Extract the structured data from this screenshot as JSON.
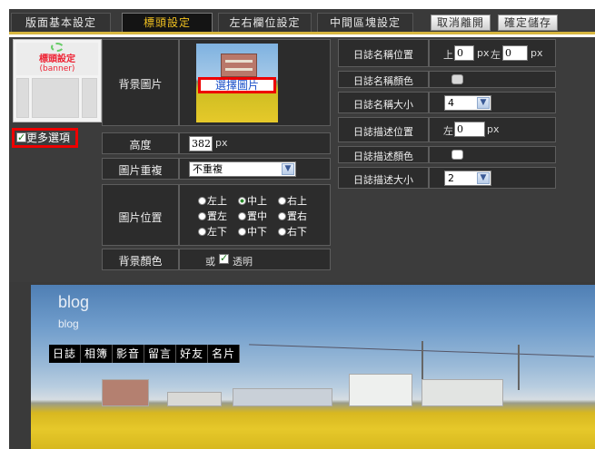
{
  "tabs": [
    {
      "label": "版面基本設定",
      "active": false
    },
    {
      "label": "標頭設定",
      "active": true
    },
    {
      "label": "左右欄位設定",
      "active": false
    },
    {
      "label": "中間區塊設定",
      "active": false
    }
  ],
  "actions": {
    "cancel": "取消離開",
    "save": "確定儲存"
  },
  "thumbnail": {
    "title": "標頭設定",
    "subtitle": "(banner)"
  },
  "more_options": {
    "label": "更多選項",
    "checked": true
  },
  "left_settings": {
    "bg_image_label": "背景圖片",
    "pick_image_button": "選擇圖片",
    "height_label": "高度",
    "height_value": "382",
    "height_unit": "px",
    "repeat_label": "圖片重複",
    "repeat_value": "不重複",
    "position_label": "圖片位置",
    "positions": [
      [
        "左上",
        "中上",
        "右上"
      ],
      [
        "置左",
        "置中",
        "置右"
      ],
      [
        "左下",
        "中下",
        "右下"
      ]
    ],
    "selected_position": "中上",
    "bg_color_label": "背景顏色",
    "bg_color_or": "或",
    "transparent_label": "透明",
    "transparent_checked": true
  },
  "right_settings": {
    "title_pos_label": "日誌名稱位置",
    "title_pos_top_prefix": "上",
    "title_pos_top_value": "0",
    "title_pos_top_unit": "px",
    "title_pos_left_prefix": "左",
    "title_pos_left_value": "0",
    "title_pos_left_unit": "px",
    "title_color_label": "日誌名稱顏色",
    "title_size_label": "日誌名稱大小",
    "title_size_value": "4",
    "desc_pos_label": "日誌描述位置",
    "desc_pos_left_prefix": "左",
    "desc_pos_left_value": "0",
    "desc_pos_unit": "px",
    "desc_color_label": "日誌描述顏色",
    "desc_size_label": "日誌描述大小",
    "desc_size_value": "2"
  },
  "preview": {
    "blog_title": "blog",
    "blog_description": "blog",
    "nav": [
      "日誌",
      "相簿",
      "影音",
      "留言",
      "好友",
      "名片"
    ]
  },
  "colors": {
    "panel_bg": "#3c3c3c",
    "cell_bg": "#2c2c2c",
    "active_tab_text": "#f0c020",
    "highlight_border": "#e00000",
    "link_blue": "#1c50c8"
  }
}
